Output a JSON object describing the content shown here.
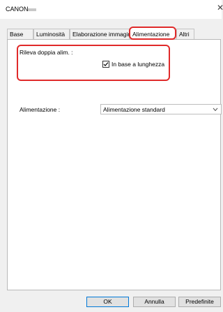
{
  "window": {
    "title": "CANON",
    "close_glyph": "✕"
  },
  "tabs": [
    {
      "label": "Base"
    },
    {
      "label": "Luminosità"
    },
    {
      "label": "Elaborazione immagin"
    },
    {
      "label": "Alimentazione",
      "active": true
    },
    {
      "label": "Altri"
    }
  ],
  "double_feed": {
    "label": "Rileva doppia alim. :",
    "option_label": "In base a lunghezza",
    "checked": true
  },
  "feeding": {
    "label": "Alimentazione :",
    "selected": "Alimentazione standard"
  },
  "buttons": {
    "ok": "OK",
    "cancel": "Annulla",
    "defaults": "Predefinite"
  },
  "colors": {
    "highlight": "#e02a2a",
    "default_button_border": "#0078d7"
  },
  "icons": {
    "close": "close-icon",
    "checkmark": "checkmark-icon",
    "dropdown": "chevron-down-icon"
  }
}
